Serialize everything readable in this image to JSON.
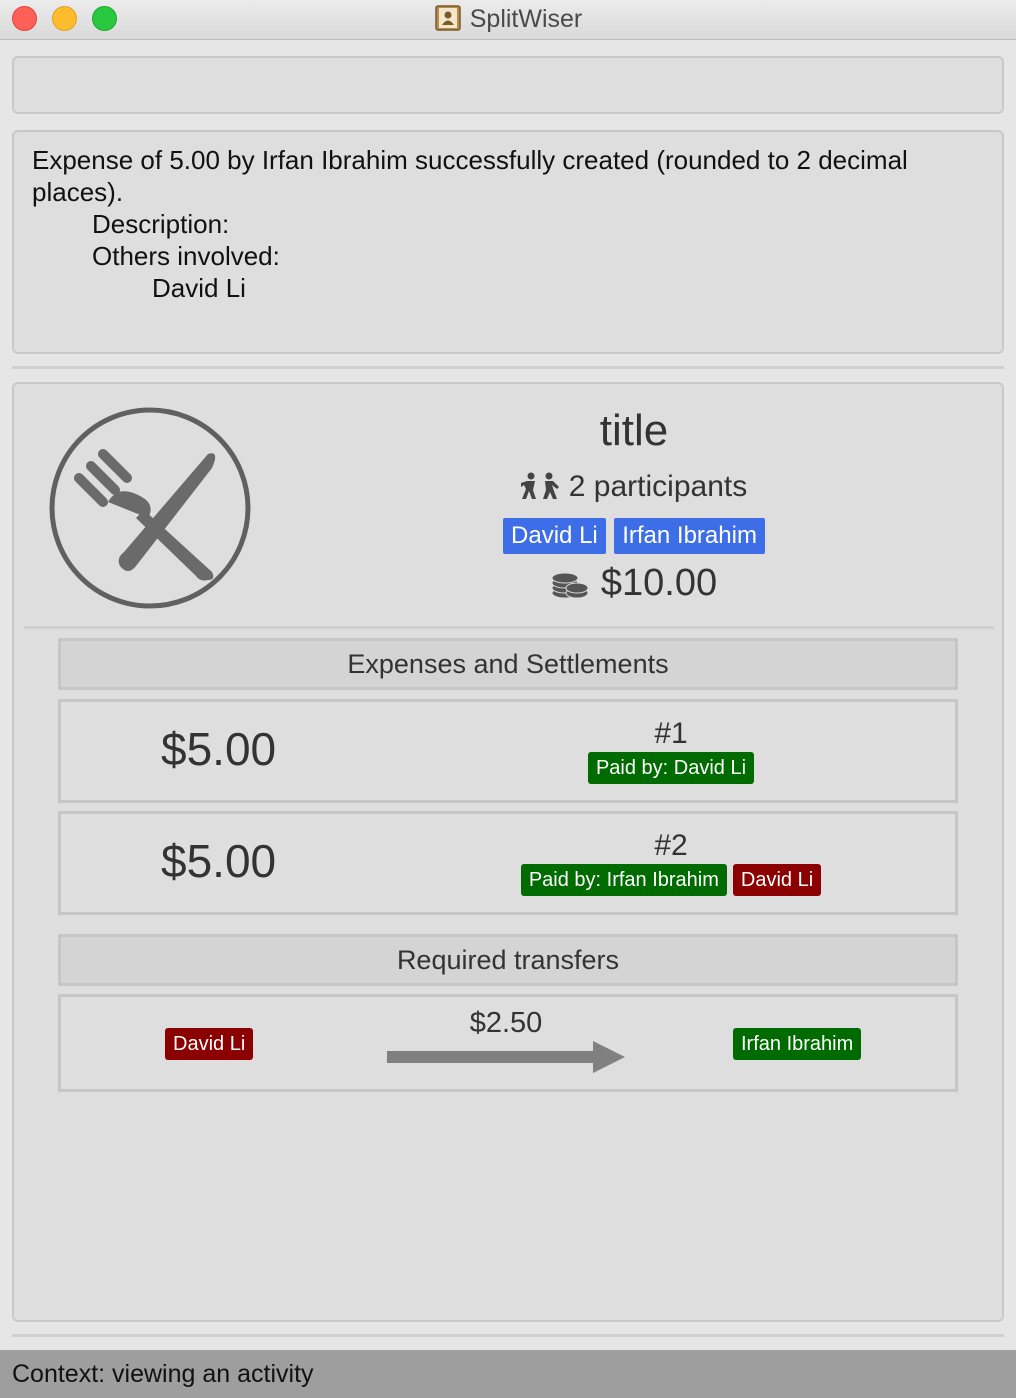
{
  "window": {
    "title": "SplitWiser",
    "icon": "contacts-book-icon"
  },
  "command": {
    "value": ""
  },
  "result": {
    "line1": "Expense of 5.00 by Irfan Ibrahim successfully created (rounded to 2 decimal places).",
    "description_label": "Description:",
    "others_label": "Others involved:",
    "others": [
      "David Li"
    ]
  },
  "activity": {
    "icon": "fork-knife-icon",
    "title": "title",
    "participants_text": "2 participants",
    "participants": [
      "David Li",
      "Irfan Ibrahim"
    ],
    "total": "$10.00",
    "colors": {
      "participant_tag": "#3d6ee8",
      "payer_tag": "#006b00",
      "debtor_tag": "#8b0000"
    }
  },
  "expenses_section": {
    "header": "Expenses and Settlements",
    "items": [
      {
        "amount": "$5.00",
        "number": "#1",
        "paid_by": "Paid by: David Li",
        "involved": []
      },
      {
        "amount": "$5.00",
        "number": "#2",
        "paid_by": "Paid by: Irfan Ibrahim",
        "involved": [
          "David Li"
        ]
      }
    ]
  },
  "transfers_section": {
    "header": "Required transfers",
    "items": [
      {
        "from": "David Li",
        "amount": "$2.50",
        "to": "Irfan Ibrahim"
      }
    ]
  },
  "status": {
    "text": "Context: viewing an activity"
  }
}
